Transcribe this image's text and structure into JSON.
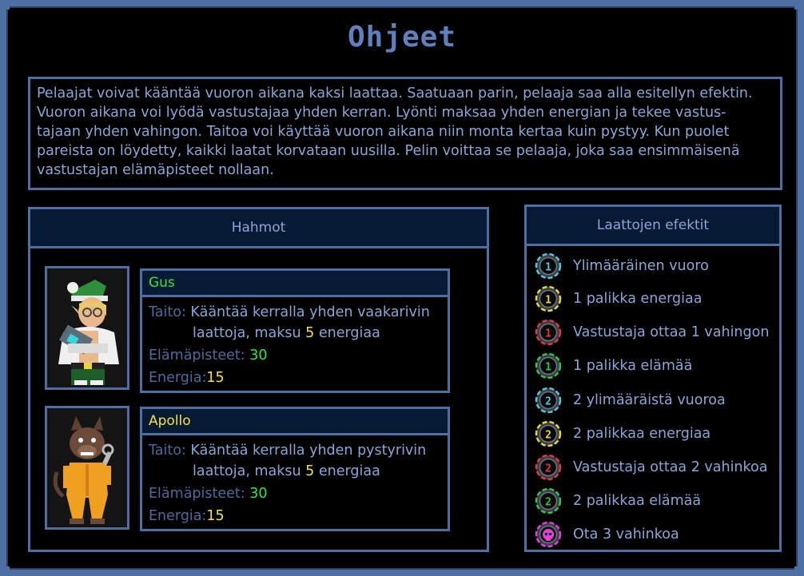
{
  "title": "Ohjeet",
  "intro": "Pelaajat voivat kääntää vuoron aikana kaksi laattaa. Saatuaan parin, pelaaja saa alla esitellyn efektin. Vuoron aikana voi lyödä vastustajaa yhden kerran. Lyönti maksaa yhden energian ja tekee vastus- tajaan yhden vahingon. Taitoa voi käyttää vuoron aikana niin monta kertaa kuin pystyy. Kun puolet pareista on löydetty, kaikki laatat korvataan uusilla. Pelin voittaa se pelaaja, joka saa ensimmäisenä vastustajan elämäpisteet nollaan.",
  "characters_header": "Hahmot",
  "effects_header": "Laattojen efektit",
  "characters": [
    {
      "name": "Gus",
      "skill_label": "Taito:",
      "skill_line1": "Kääntää kerralla yhden vaakarivin",
      "skill_line2a": "laattoja, maksu",
      "skill_cost": "5",
      "skill_line2b": "energiaa",
      "hp_label": "Elämäpisteet:",
      "hp": "30",
      "energy_label": "Energia:",
      "energy": "15"
    },
    {
      "name": "Apollo",
      "skill_label": "Taito:",
      "skill_line1": "Kääntää kerralla yhden pystyrivin",
      "skill_line2a": "laattoja, maksu",
      "skill_cost": "5",
      "skill_line2b": "energiaa",
      "hp_label": "Elämäpisteet:",
      "hp": "30",
      "energy_label": "Energia:",
      "energy": "15"
    }
  ],
  "effects": [
    {
      "label": "Ylimääräinen vuoro",
      "icon": "turn-1-icon",
      "num": "1",
      "color": "#56c7d6"
    },
    {
      "label": "1 palikka energiaa",
      "icon": "energy-1-icon",
      "num": "1",
      "color": "#e8d63a"
    },
    {
      "label": "Vastustaja ottaa 1 vahingon",
      "icon": "damage-1-icon",
      "num": "1",
      "color": "#e03a3a"
    },
    {
      "label": "1 palikka elämää",
      "icon": "health-1-icon",
      "num": "1",
      "color": "#37c24a"
    },
    {
      "label": "2 ylimääräistä vuoroa",
      "icon": "turn-2-icon",
      "num": "2",
      "color": "#56c7d6"
    },
    {
      "label": "2 palikkaa energiaa",
      "icon": "energy-2-icon",
      "num": "2",
      "color": "#e8d63a"
    },
    {
      "label": "Vastustaja ottaa 2 vahinkoa",
      "icon": "damage-2-icon",
      "num": "2",
      "color": "#e03a3a"
    },
    {
      "label": "2 palikkaa elämää",
      "icon": "health-2-icon",
      "num": "2",
      "color": "#37c24a"
    },
    {
      "label": "Ota 3 vahinkoa",
      "icon": "skull-icon",
      "num": "",
      "color": "#e040e0"
    }
  ]
}
